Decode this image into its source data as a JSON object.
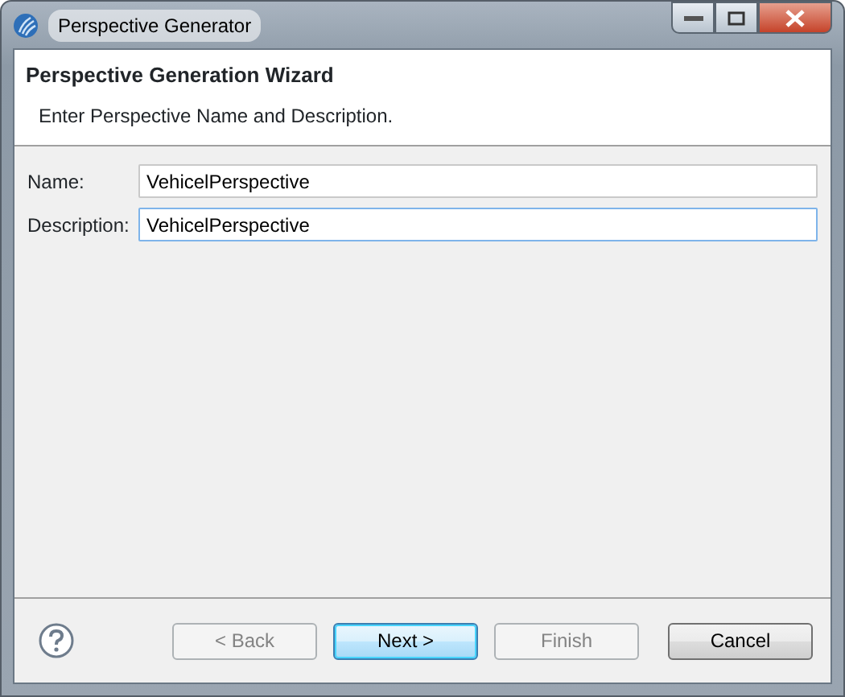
{
  "window": {
    "title": "Perspective Generator"
  },
  "header": {
    "title": "Perspective Generation Wizard",
    "description": "Enter Perspective Name and Description."
  },
  "fields": [
    {
      "label": "Name:",
      "value": "VehicelPerspective",
      "focused": false
    },
    {
      "label": "Description:",
      "value": "VehicelPerspective",
      "focused": true
    }
  ],
  "buttons": [
    {
      "label": "< Back",
      "disabled": true,
      "default": false
    },
    {
      "label": "Next >",
      "disabled": false,
      "default": true
    },
    {
      "label": "Finish",
      "disabled": true,
      "default": false
    },
    {
      "label": "Cancel",
      "disabled": false,
      "default": false
    }
  ]
}
